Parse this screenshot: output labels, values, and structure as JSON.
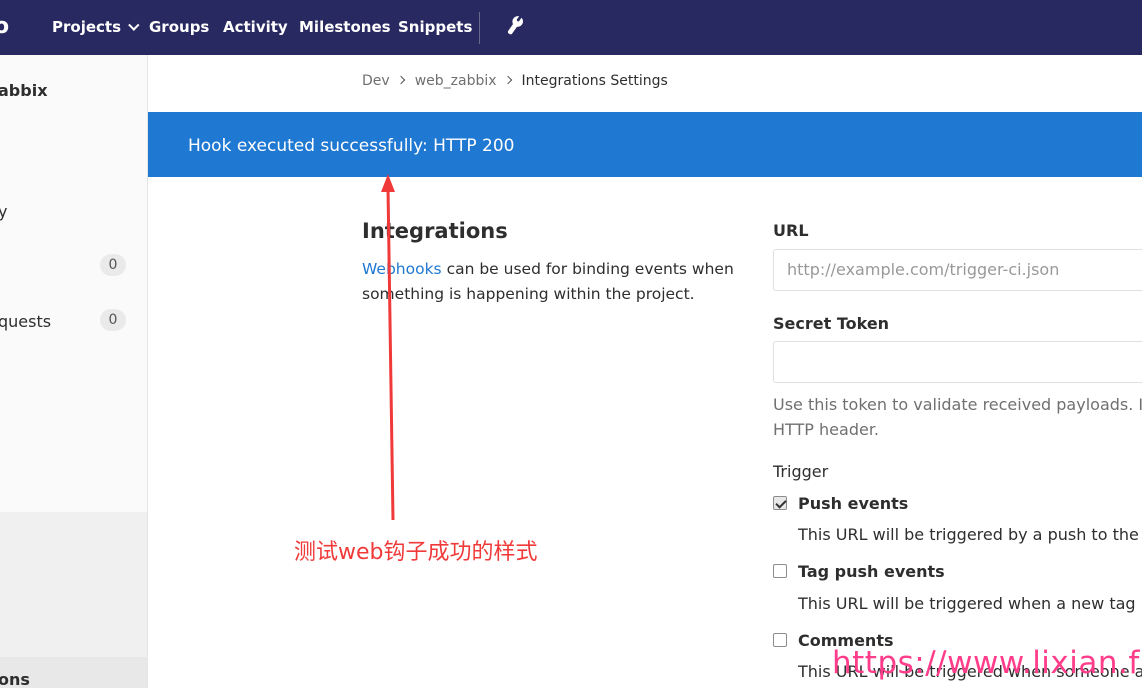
{
  "navbar": {
    "logo_fragment": "o",
    "items": [
      "Projects",
      "Groups",
      "Activity",
      "Milestones",
      "Snippets"
    ]
  },
  "sidebar": {
    "project_name": "abbix",
    "item_activity": "y",
    "issues_count": "0",
    "merge_requests_label": "quests",
    "merge_requests_count": "0",
    "bottom_item": "ons"
  },
  "breadcrumb": {
    "items": [
      "Dev",
      "web_zabbix",
      "Integrations Settings"
    ]
  },
  "flash": {
    "message": "Hook executed successfully: HTTP 200"
  },
  "integrations": {
    "title": "Integrations",
    "link_text": "Webhooks",
    "desc_rest": " can be used for binding events when something is happening within the project."
  },
  "form": {
    "url_label": "URL",
    "url_placeholder": "http://example.com/trigger-ci.json",
    "token_label": "Secret Token",
    "token_value": "",
    "token_help_line1": "Use this token to validate received payloads. It w",
    "token_help_line2": "HTTP header.",
    "trigger_label": "Trigger",
    "triggers": [
      {
        "label": "Push events",
        "help": "This URL will be triggered by a push to the re",
        "checked": true
      },
      {
        "label": "Tag push events",
        "help": "This URL will be triggered when a new tag is",
        "checked": false
      },
      {
        "label": "Comments",
        "help": "This URL will be triggered when someone ad",
        "checked": false
      }
    ]
  },
  "annotation": {
    "text": "测试web钩子成功的样式",
    "color": "#f03a3a"
  },
  "watermark": {
    "text": "https://www.lixian.fun",
    "color": "#ff3d8b"
  },
  "colors": {
    "navbar": "#292961",
    "flash": "#1f78d1",
    "link": "#1f78d1"
  }
}
